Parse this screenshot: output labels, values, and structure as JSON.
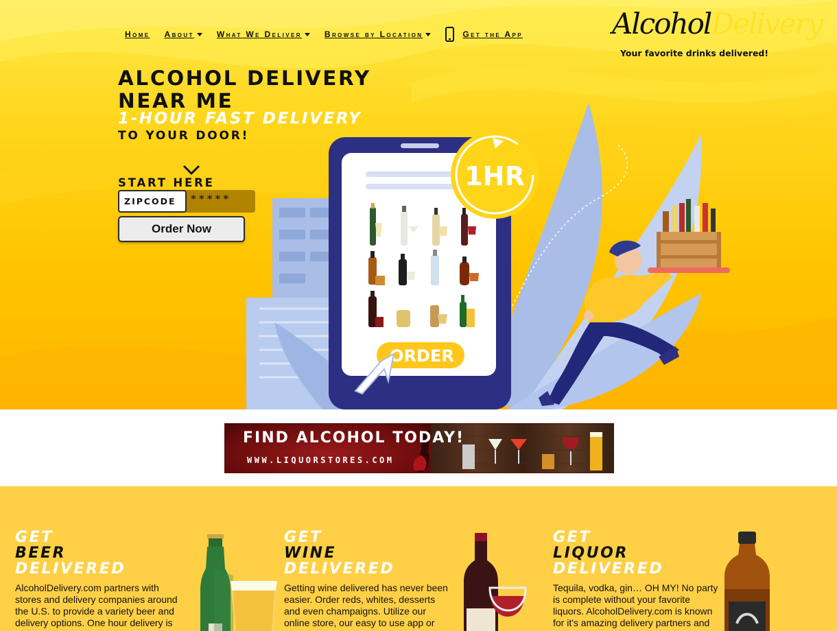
{
  "nav": {
    "items": [
      {
        "label": "Home",
        "dropdown": false
      },
      {
        "label": "About",
        "dropdown": true
      },
      {
        "label": "What We Deliver",
        "dropdown": true
      },
      {
        "label": "Browse by Location",
        "dropdown": true
      }
    ],
    "app_label": "Get the App",
    "app_icon": "phone-icon"
  },
  "logo": {
    "word1": "Alcohol",
    "word2": "Delivery",
    "tagline": "Your favorite drinks delivered!"
  },
  "hero": {
    "heading_line1": "ALCOHOL DELIVERY",
    "heading_line2": "NEAR ME",
    "subheading": "1-HOUR FAST DELIVERY",
    "subheading2": "TO YOUR DOOR!",
    "start_label": "START HERE",
    "zip_placeholder": "ZIPCODE",
    "zip_mask": "*****",
    "order_button": "Order Now",
    "badge_text": "1HR",
    "phone_button_text": "ORDER"
  },
  "ad": {
    "title": "FIND ALCOHOL TODAY!",
    "url": "WWW.LIQUORSTORES.COM"
  },
  "categories": [
    {
      "line1": "GET",
      "line2": "BEER",
      "line3": "DELIVERED",
      "text": "AlcoholDelivery.com partners with stores and delivery companies around the U.S. to provide a variety beer and delivery options. One hour delivery is available in most major"
    },
    {
      "line1": "GET",
      "line2": "WINE",
      "line3": "DELIVERED",
      "text": "Getting wine delivered has never been easier. Order reds, whites, desserts and even champaigns. Utilize our online store, our easy to use app or use the directory to find"
    },
    {
      "line1": "GET",
      "line2": "LIQUOR",
      "line3": "DELIVERED",
      "text": "Tequila, vodka, gin… OH MY! No party is complete without your favorite liquors. AlcoholDelivery.com is known for it's amazing delivery partners and fast delivery times."
    }
  ],
  "colors": {
    "hero_yellow": "#ffc400",
    "category_band": "#ffd046",
    "phone_navy": "#2d2f82",
    "leaf_blue": "#a9bde6"
  }
}
